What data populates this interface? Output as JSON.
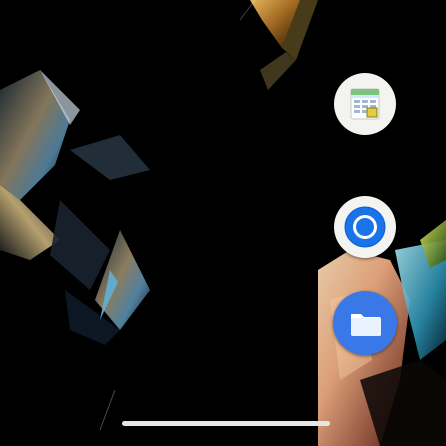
{
  "home_screen": {
    "apps": [
      {
        "id": "sheets",
        "icon": "spreadsheet-app-icon"
      },
      {
        "id": "chrome",
        "icon": "chrome-icon"
      },
      {
        "id": "files",
        "icon": "folder-icon"
      }
    ],
    "navigation": {
      "icon": "gesture-nav-handle"
    }
  },
  "colors": {
    "background": "#000000",
    "files_blue": "#3a78e8",
    "chrome_blue": "#1a73e8",
    "sheet_green": "#2e9e4f"
  }
}
